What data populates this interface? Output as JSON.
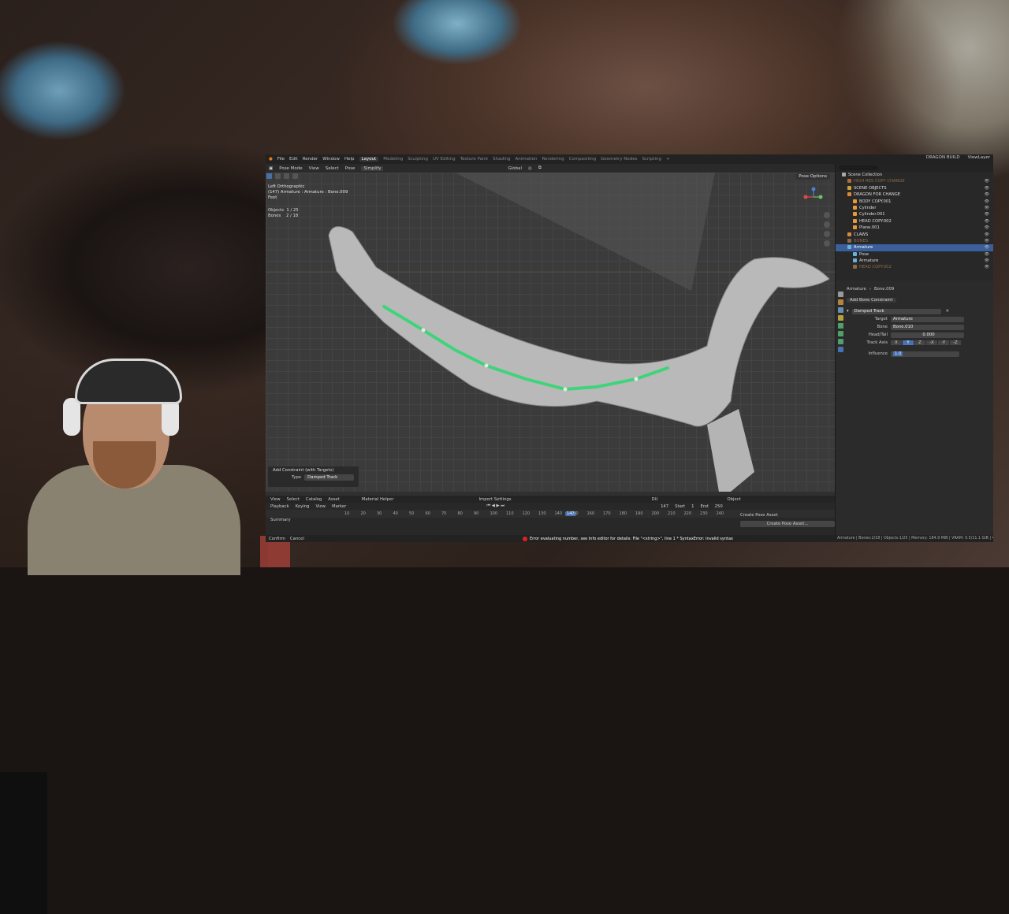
{
  "app": {
    "menus": [
      "File",
      "Edit",
      "Render",
      "Window",
      "Help"
    ],
    "workspaces": [
      "Layout",
      "Modeling",
      "Sculpting",
      "UV Editing",
      "Texture Paint",
      "Shading",
      "Animation",
      "Rendering",
      "Compositing",
      "Geometry Nodes",
      "Scripting"
    ],
    "active_workspace": "Layout",
    "scene_name": "DRAGON BUILD",
    "view_layer": "ViewLayer"
  },
  "viewport_header": {
    "mode": "Pose Mode",
    "menus": [
      "View",
      "Select",
      "Pose"
    ],
    "extra": "Simplify",
    "transform_orientation": "Global",
    "pose_options": "Pose Options"
  },
  "viewport": {
    "view_name": "Left Orthographic",
    "active": "(147) Armature : Armature : Bone.009",
    "units": "Feet",
    "objects_label": "Objects",
    "objects_value": "1 / 25",
    "bones_label": "Bones",
    "bones_value": "2 / 18"
  },
  "operator_panel": {
    "title": "Add Constraint (with Targets)",
    "type_label": "Type",
    "type_value": "Damped Track"
  },
  "timeline": {
    "header_menus": [
      "View",
      "Select",
      "Catalog",
      "Asset"
    ],
    "material_helper": "Material Helper",
    "import_settings": "Import Settings",
    "playback": "Playback",
    "keying": "Keying",
    "view": "View",
    "marker": "Marker",
    "current_frame": "147",
    "start_label": "Start",
    "start_value": "1",
    "end_label": "End",
    "end_value": "250",
    "ruler": [
      "10",
      "20",
      "30",
      "40",
      "50",
      "60",
      "70",
      "80",
      "90",
      "100",
      "110",
      "120",
      "130",
      "140",
      "150",
      "160",
      "170",
      "180",
      "190",
      "200",
      "210",
      "220",
      "230",
      "240"
    ],
    "summary": "Summary",
    "pose_lib_object": "Object",
    "create_pose_asset": "Create Pose Asset",
    "create_pose_asset_btn": "Create Pose Asset...",
    "du": "DU"
  },
  "statusbar": {
    "confirm": "Confirm",
    "cancel": "Cancel",
    "error": "Error evaluating number, see Info editor for details: File \"<string>\", line 1    * SyntaxError: invalid syntax",
    "right": "Armature | Bones:2/18 | Objects:1/25 | Memory: 184.9 MiB | VRAM: 0.5/11.1 GiB | 4.0.2"
  },
  "outliner": {
    "root": "Scene Collection",
    "items": [
      {
        "label": "HIGH RES COPY CHANGE",
        "level": 1,
        "color": "#b36a3a",
        "dim": true
      },
      {
        "label": "SCENE OBJECTS",
        "level": 1,
        "color": "#c9a23a"
      },
      {
        "label": "DRAGON FOR CHANGE",
        "level": 1,
        "color": "#d88a3a"
      },
      {
        "label": "BODY COPY.001",
        "level": 2,
        "color": "#e89a3a"
      },
      {
        "label": "Cylinder",
        "level": 2,
        "color": "#e89a3a"
      },
      {
        "label": "Cylinder.001",
        "level": 2,
        "color": "#e89a3a"
      },
      {
        "label": "HEAD COPY.002",
        "level": 2,
        "color": "#e89a3a"
      },
      {
        "label": "Plane.001",
        "level": 2,
        "color": "#e89a3a"
      },
      {
        "label": "CLAWS",
        "level": 1,
        "color": "#d88a3a"
      },
      {
        "label": "BONES",
        "level": 1,
        "color": "#8d6b4a",
        "dim": true
      },
      {
        "label": "Armature",
        "level": 1,
        "color": "#6bb0e0",
        "selected": true
      },
      {
        "label": "Pose",
        "level": 2,
        "color": "#6bb0e0"
      },
      {
        "label": "Armature",
        "level": 2,
        "color": "#6bb0e0"
      },
      {
        "label": "HEAD COPY.002",
        "level": 2,
        "color": "#8d6b4a",
        "dim": true
      }
    ]
  },
  "properties": {
    "breadcrumb_obj": "Armature",
    "breadcrumb_bone": "Bone.009",
    "add_constraint": "Add Bone Constraint",
    "constraint_name": "Damped Track",
    "target_label": "Target",
    "target_value": "Armature",
    "bone_label": "Bone",
    "bone_value": "Bone.010",
    "headtail_label": "Head/Tail",
    "headtail_value": "0.000",
    "track_axis_label": "Track Axis",
    "axes": [
      "X",
      "Y",
      "Z",
      "-X",
      "-Y",
      "-Z"
    ],
    "active_axis": "Y",
    "influence_label": "Influence",
    "influence_value": "1.0"
  },
  "colors": {
    "accent": "#4772b3",
    "bone_green": "#3fd47a",
    "selected_row": "#3a5f9a",
    "error": "#dd2222"
  }
}
